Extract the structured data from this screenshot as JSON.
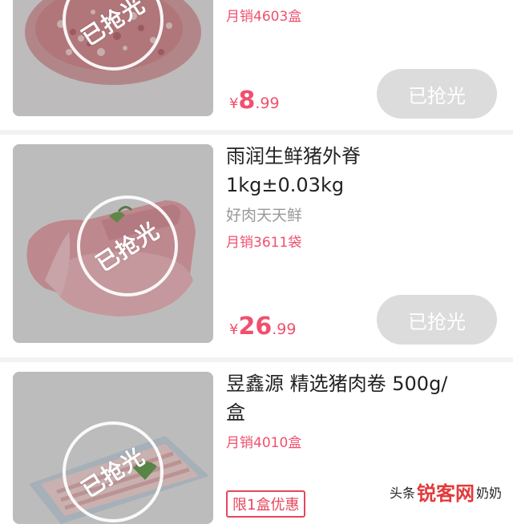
{
  "products": [
    {
      "sales": "月销4603盒",
      "price": {
        "currency": "¥",
        "integer": "8",
        "decimal": ".99"
      },
      "status_stamp": "已抢光",
      "button_label": "已抢光"
    },
    {
      "title_line1": "雨润生鲜猪外脊",
      "title_line2": "1kg±0.03kg",
      "subtitle": "好肉天天鲜",
      "sales": "月销3611袋",
      "price": {
        "currency": "¥",
        "integer": "26",
        "decimal": ".99"
      },
      "status_stamp": "已抢光",
      "button_label": "已抢光"
    },
    {
      "title_line1": "昱鑫源 精选猪肉卷 500g/",
      "title_line2": "盒",
      "sales": "月销4010盒",
      "promo_tag": "限1盒优惠",
      "status_stamp": "已抢光"
    }
  ],
  "watermark": {
    "prefix": "头条",
    "logo": "锐客网",
    "suffix": "奶奶"
  },
  "colors": {
    "accent": "#f0506e",
    "button_disabled": "#dcdcdc"
  }
}
